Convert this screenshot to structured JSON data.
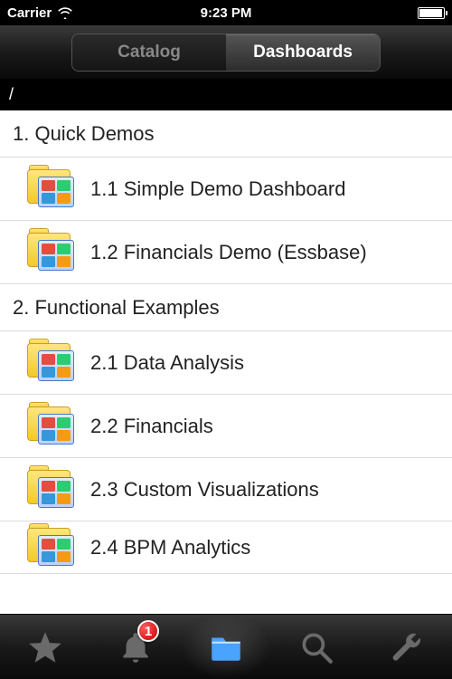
{
  "statusBar": {
    "carrier": "Carrier",
    "time": "9:23 PM"
  },
  "nav": {
    "tabs": [
      {
        "label": "Catalog",
        "active": false
      },
      {
        "label": "Dashboards",
        "active": true
      }
    ]
  },
  "breadcrumb": "/",
  "sections": [
    {
      "title": "1. Quick Demos",
      "items": [
        {
          "label": "1.1 Simple Demo Dashboard"
        },
        {
          "label": "1.2 Financials Demo (Essbase)"
        }
      ]
    },
    {
      "title": "2. Functional Examples",
      "items": [
        {
          "label": "2.1 Data Analysis"
        },
        {
          "label": "2.2 Financials"
        },
        {
          "label": "2.3 Custom Visualizations"
        },
        {
          "label": "2.4 BPM Analytics"
        }
      ]
    }
  ],
  "tabBar": {
    "alertsBadge": "1"
  }
}
